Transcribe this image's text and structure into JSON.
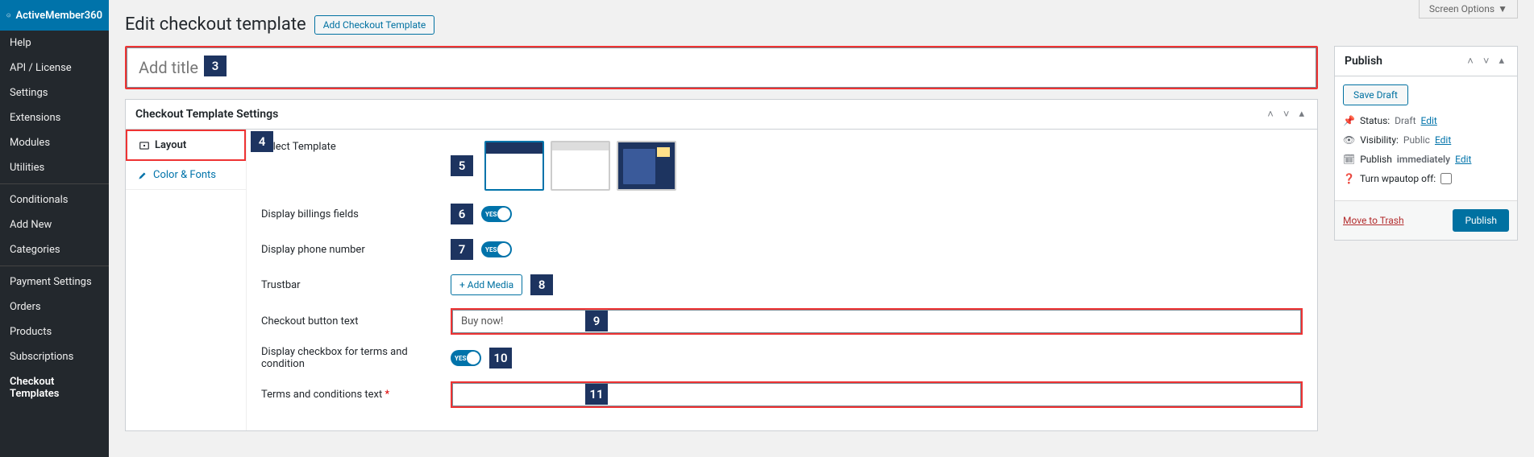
{
  "brand": "ActiveMember360",
  "sidebar": {
    "items": [
      {
        "label": "Help"
      },
      {
        "label": "API / License"
      },
      {
        "label": "Settings"
      },
      {
        "label": "Extensions"
      },
      {
        "label": "Modules"
      },
      {
        "label": "Utilities"
      }
    ],
    "items2": [
      {
        "label": "Conditionals"
      },
      {
        "label": "Add New"
      },
      {
        "label": "Categories"
      }
    ],
    "items3": [
      {
        "label": "Payment Settings"
      },
      {
        "label": "Orders"
      },
      {
        "label": "Products"
      },
      {
        "label": "Subscriptions"
      },
      {
        "label": "Checkout Templates",
        "active": true
      }
    ]
  },
  "screen_options": "Screen Options",
  "page_title": "Edit checkout template",
  "add_template_btn": "Add Checkout Template",
  "title_placeholder": "Add title",
  "badges": {
    "b3": "3",
    "b4": "4",
    "b5": "5",
    "b6": "6",
    "b7": "7",
    "b8": "8",
    "b9": "9",
    "b10": "10",
    "b11": "11"
  },
  "metabox": {
    "title": "Checkout Template Settings",
    "tabs": {
      "layout": "Layout",
      "colors": "Color & Fonts"
    },
    "fields": {
      "select_template": "Select Template",
      "display_billing": "Display billings fields",
      "display_phone": "Display phone number",
      "trustbar": "Trustbar",
      "add_media": "+ Add Media",
      "checkout_btn_text": "Checkout button text",
      "checkout_btn_value": "Buy now!",
      "display_terms": "Display checkbox for terms and condition",
      "terms_text": "Terms and conditions text",
      "toggle_yes": "YES"
    }
  },
  "publish": {
    "title": "Publish",
    "save_draft": "Save Draft",
    "status_label": "Status:",
    "status_value": "Draft",
    "visibility_label": "Visibility:",
    "visibility_value": "Public",
    "publish_label": "Publish",
    "publish_value": "immediately",
    "wpautop_label": "Turn wpautop off:",
    "edit": "Edit",
    "trash": "Move to Trash",
    "publish_btn": "Publish"
  }
}
